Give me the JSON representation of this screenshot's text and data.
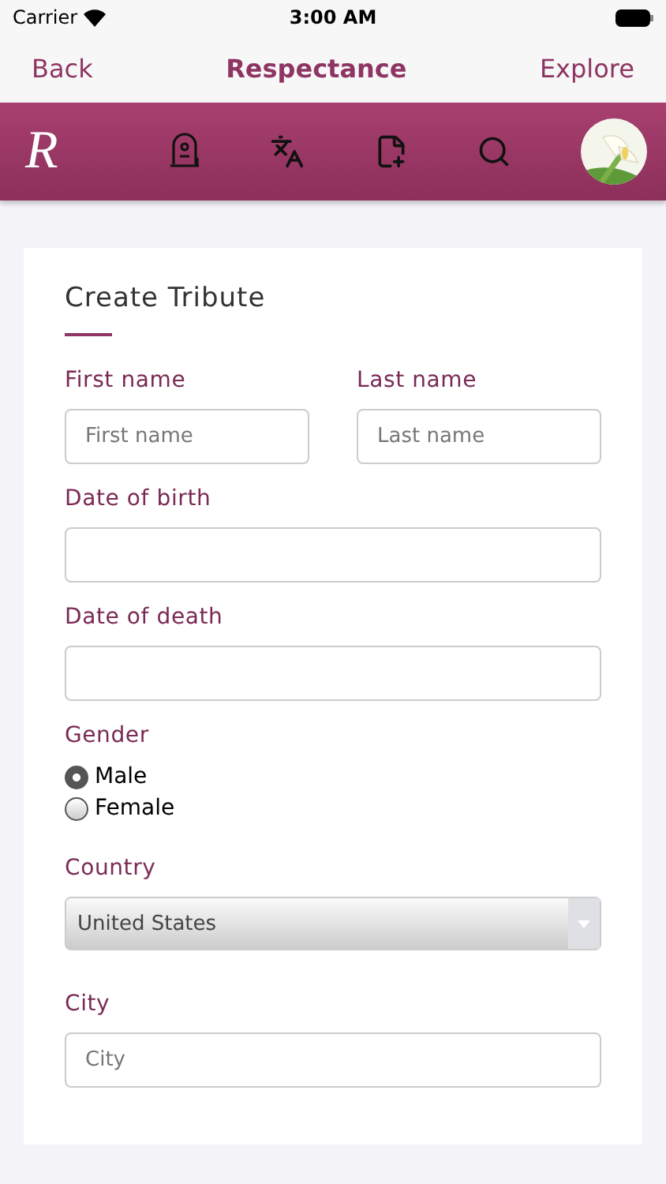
{
  "status_bar": {
    "carrier": "Carrier",
    "time": "3:00 AM"
  },
  "nav": {
    "back": "Back",
    "title": "Respectance",
    "action": "Explore"
  },
  "toolbar": {
    "logo": "R",
    "icons": [
      {
        "kind": "grave"
      },
      {
        "kind": "translate"
      },
      {
        "kind": "add-file"
      },
      {
        "kind": "search"
      }
    ]
  },
  "form": {
    "title": "Create Tribute",
    "name_fields": [
      {
        "label": "First name",
        "placeholder": "First name"
      },
      {
        "label": "Last name",
        "placeholder": "Last name"
      }
    ],
    "fields": [
      {
        "kind": "text",
        "label": "Date of birth"
      },
      {
        "kind": "text",
        "label": "Date of death"
      },
      {
        "kind": "radio",
        "label": "Gender",
        "options": [
          {
            "label": "Male",
            "selected": true
          },
          {
            "label": "Female",
            "selected": false
          }
        ]
      },
      {
        "kind": "select",
        "label": "Country",
        "value": "United States"
      },
      {
        "kind": "text",
        "label": "City",
        "placeholder": "City"
      }
    ]
  }
}
